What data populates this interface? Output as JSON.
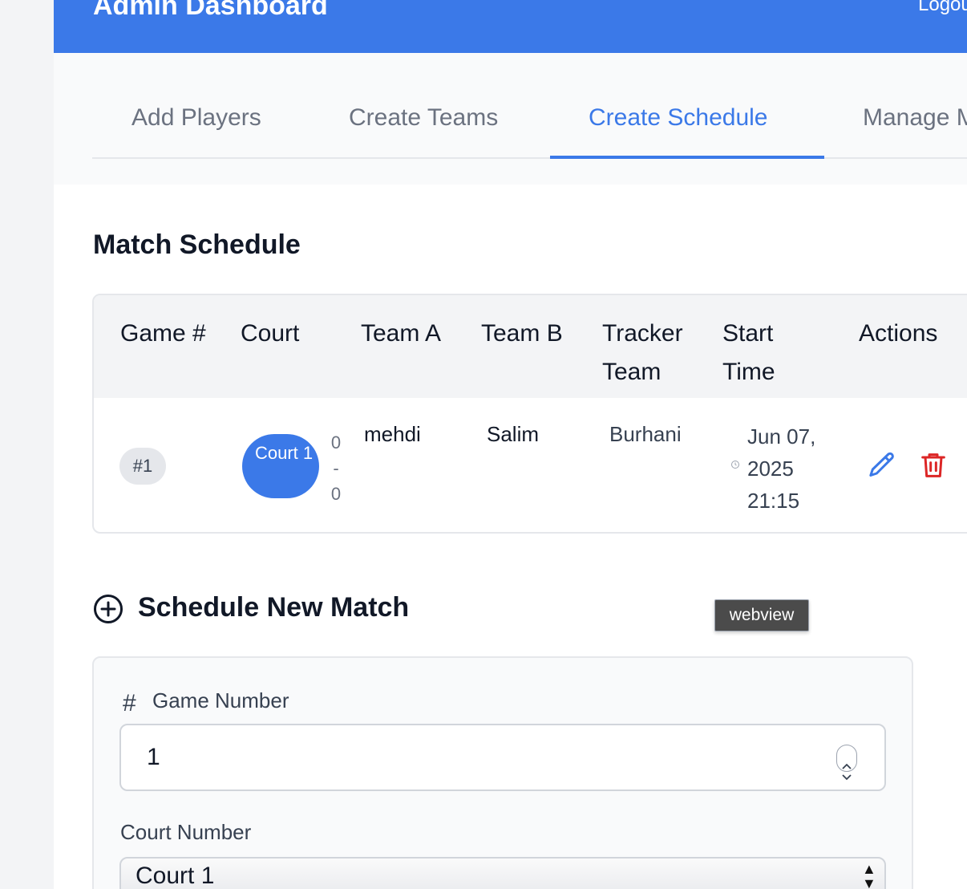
{
  "header": {
    "title": "Admin Dashboard",
    "logout_label": "Logout"
  },
  "tabs": [
    {
      "label": "Add Players",
      "active": false
    },
    {
      "label": "Create Teams",
      "active": false
    },
    {
      "label": "Create Schedule",
      "active": true
    },
    {
      "label": "Manage Matches",
      "active": false
    }
  ],
  "schedule": {
    "title": "Match Schedule",
    "columns": [
      "Game #",
      "Court",
      "Team A",
      "Team B",
      "Tracker Team",
      "Start Time",
      "Actions"
    ],
    "rows": [
      {
        "game": "#1",
        "court": "Court 1",
        "score_a": "0",
        "score_sep": "-",
        "score_b": "0",
        "team_a": "mehdi",
        "team_b": "Salim",
        "tracker": "Burhani",
        "start_time": "Jun 07,\n2025\n21:15"
      }
    ]
  },
  "new_match": {
    "title": "Schedule New Match",
    "game_number_label": "Game Number",
    "game_number_value": "1",
    "court_label": "Court Number",
    "court_value": "Court 1"
  },
  "tooltip": "webview",
  "colors": {
    "accent": "#3b79e8",
    "danger": "#dc2626"
  },
  "icons": [
    "plus-circle-icon",
    "hash-icon",
    "clock-icon",
    "pencil-icon",
    "trash-icon"
  ]
}
